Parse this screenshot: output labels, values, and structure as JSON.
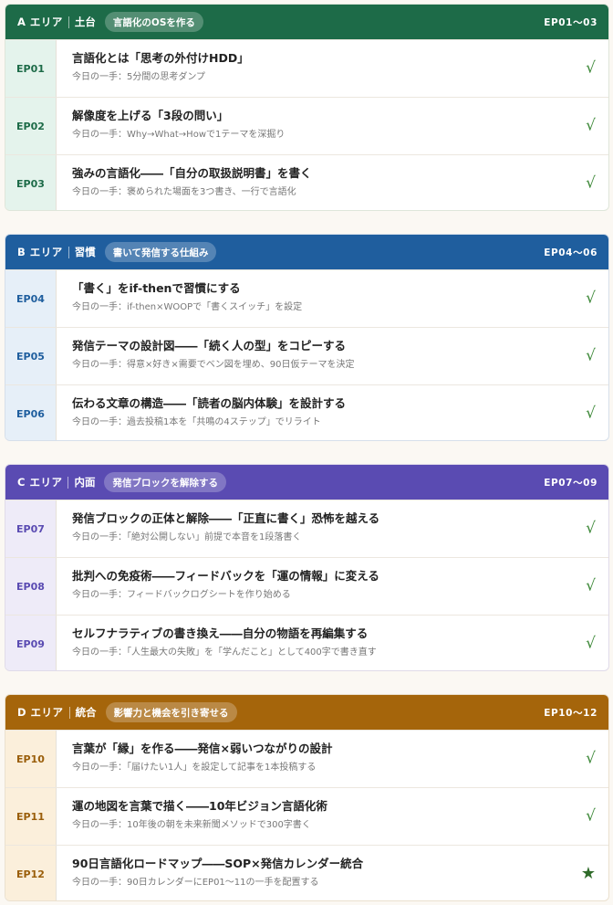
{
  "sections": [
    {
      "area": "A エリア",
      "category": "土台",
      "tagline": "言語化のOSを作る",
      "range": "EP01〜03",
      "color": "#1d6b48",
      "episodes": [
        {
          "ep": "EP01",
          "title": "言語化とは「思考の外付けHDD」",
          "sub": "今日の一手：5分間の思考ダンプ",
          "mark": "√"
        },
        {
          "ep": "EP02",
          "title": "解像度を上げる「3段の問い」",
          "sub": "今日の一手：Why→What→Howで1テーマを深掘り",
          "mark": "√"
        },
        {
          "ep": "EP03",
          "title": "強みの言語化――「自分の取扱説明書」を書く",
          "sub": "今日の一手：褒められた場面を3つ書き、一行で言語化",
          "mark": "√"
        }
      ]
    },
    {
      "area": "B エリア",
      "category": "習慣",
      "tagline": "書いて発信する仕組み",
      "range": "EP04〜06",
      "color": "#1f5e9e",
      "episodes": [
        {
          "ep": "EP04",
          "title": "「書く」をif-thenで習慣にする",
          "sub": "今日の一手：if-then×WOOPで「書くスイッチ」を設定",
          "mark": "√"
        },
        {
          "ep": "EP05",
          "title": "発信テーマの設計図――「続く人の型」をコピーする",
          "sub": "今日の一手：得意×好き×需要でベン図を埋め、90日仮テーマを決定",
          "mark": "√"
        },
        {
          "ep": "EP06",
          "title": "伝わる文章の構造――「読者の脳内体験」を設計する",
          "sub": "今日の一手：過去投稿1本を「共鳴の4ステップ」でリライト",
          "mark": "√"
        }
      ]
    },
    {
      "area": "C エリア",
      "category": "内面",
      "tagline": "発信ブロックを解除する",
      "range": "EP07〜09",
      "color": "#5a4bb2",
      "episodes": [
        {
          "ep": "EP07",
          "title": "発信ブロックの正体と解除――「正直に書く」恐怖を越える",
          "sub": "今日の一手：「絶対公開しない」前提で本音を1段落書く",
          "mark": "√"
        },
        {
          "ep": "EP08",
          "title": "批判への免疫術――フィードバックを「運の情報」に変える",
          "sub": "今日の一手：フィードバックログシートを作り始める",
          "mark": "√"
        },
        {
          "ep": "EP09",
          "title": "セルフナラティブの書き換え――自分の物語を再編集する",
          "sub": "今日の一手：「人生最大の失敗」を「学んだこと」として400字で書き直す",
          "mark": "√"
        }
      ]
    },
    {
      "area": "D エリア",
      "category": "統合",
      "tagline": "影響力と機会を引き寄せる",
      "range": "EP10〜12",
      "color": "#a5650b",
      "episodes": [
        {
          "ep": "EP10",
          "title": "言葉が「縁」を作る――発信×弱いつながりの設計",
          "sub": "今日の一手：「届けたい1人」を設定して記事を1本投稿する",
          "mark": "√"
        },
        {
          "ep": "EP11",
          "title": "運の地図を言葉で描く――10年ビジョン言語化術",
          "sub": "今日の一手：10年後の朝を未来新聞メソッドで300字書く",
          "mark": "√"
        },
        {
          "ep": "EP12",
          "title": "90日言語化ロードマップ――SOP×発信カレンダー統合",
          "sub": "今日の一手：90日カレンダーにEP01〜11の一手を配置する",
          "mark": "★"
        }
      ]
    }
  ]
}
